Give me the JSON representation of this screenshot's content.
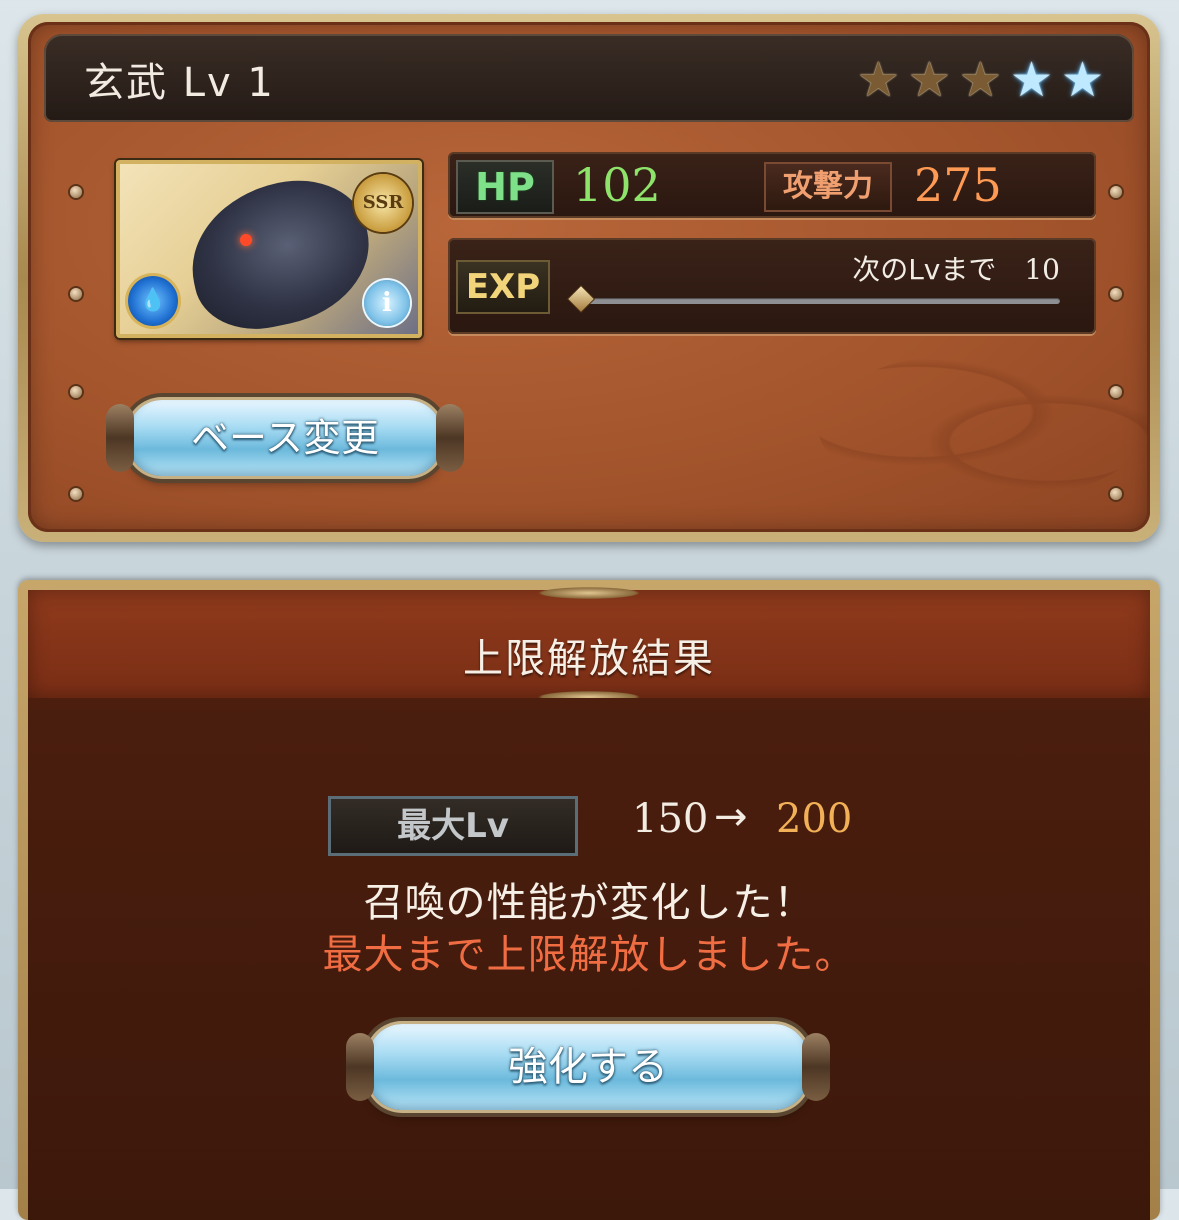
{
  "summon": {
    "name_level": "玄武 Lv 1",
    "rarity": "SSR",
    "stars": [
      {
        "type": "gold"
      },
      {
        "type": "gold"
      },
      {
        "type": "gold"
      },
      {
        "type": "blue"
      },
      {
        "type": "blue"
      }
    ],
    "element_icon": "water-element-icon",
    "info_icon_glyph": "i"
  },
  "stats": {
    "hp_label": "HP",
    "hp_value": "102",
    "atk_label": "攻撃力",
    "atk_value": "275",
    "exp_label": "EXP",
    "next_label": "次のLvまで",
    "next_value": "10",
    "exp_progress": 0.0
  },
  "buttons": {
    "base_change": "ベース変更",
    "enhance": "強化する"
  },
  "result": {
    "title": "上限解放結果",
    "max_lv_label": "最大Lv",
    "max_lv_from": "150",
    "arrow": "→",
    "max_lv_to": "200",
    "message1": "召喚の性能が変化した！",
    "message2": "最大まで上限解放しました。"
  },
  "colors": {
    "hp_value": "#8ee36a",
    "atk_value": "#ff9a55",
    "max_lv_to": "#f3b157",
    "message2": "#f06d43"
  }
}
